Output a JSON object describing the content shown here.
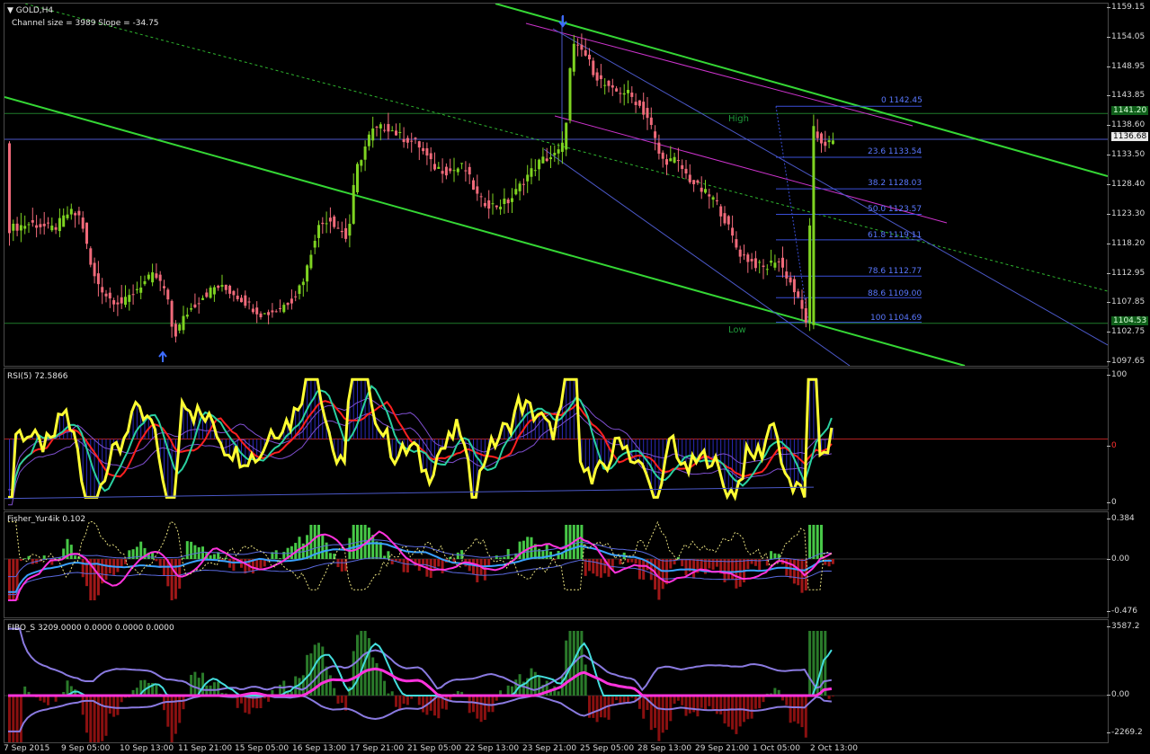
{
  "chart": {
    "symbol_label": "GOLD,H4",
    "channel_info": "Channel size = 3989 Slope = -34.75",
    "rsi_label": "RSI(5) 72.5866",
    "fisher_label": "Fisher_Yur4ik 0.102",
    "fibo_label": "FIBO_S 3209.0000 0.0000 0.0000 0.0000",
    "high_label": "High",
    "low_label": "Low",
    "price_ticks": [
      "1159.15",
      "1154.05",
      "1148.95",
      "1143.85",
      "1138.60",
      "1133.50",
      "1128.40",
      "1123.30",
      "1118.20",
      "1112.95",
      "1107.85",
      "1102.75",
      "1097.65"
    ],
    "current_price": "1136.68",
    "high_price": "1141.20",
    "low_price": "1104.53",
    "rsi_ticks": [
      "100",
      "0",
      "0"
    ],
    "fisher_ticks": [
      "0.384",
      "0.00",
      "-0.476"
    ],
    "fibo_ticks": [
      "3587.2",
      "0.00",
      "-2269.2"
    ],
    "fib_levels": [
      "0 1142.45",
      "23.6 1133.54",
      "38.2 1128.03",
      "50.0 1123.57",
      "61.8 1119.11",
      "78.6 1112.77",
      "88.6 1109.00",
      "100 1104.69"
    ],
    "time_ticks": [
      "7 Sep 2015",
      "9 Sep 05:00",
      "10 Sep 13:00",
      "11 Sep 21:00",
      "15 Sep 05:00",
      "16 Sep 13:00",
      "17 Sep 21:00",
      "21 Sep 05:00",
      "22 Sep 13:00",
      "23 Sep 21:00",
      "25 Sep 05:00",
      "28 Sep 13:00",
      "29 Sep 21:00",
      "1 Oct 05:00",
      "2 Oct 13:00"
    ]
  },
  "colors": {
    "bull": "#7ed321",
    "bear": "#f06a7a",
    "channel": "#35d735",
    "magenta": "#cc33cc",
    "blue": "#4b58c8",
    "rsi_main": "#ffff33",
    "rsi_red": "#ff2020"
  }
}
